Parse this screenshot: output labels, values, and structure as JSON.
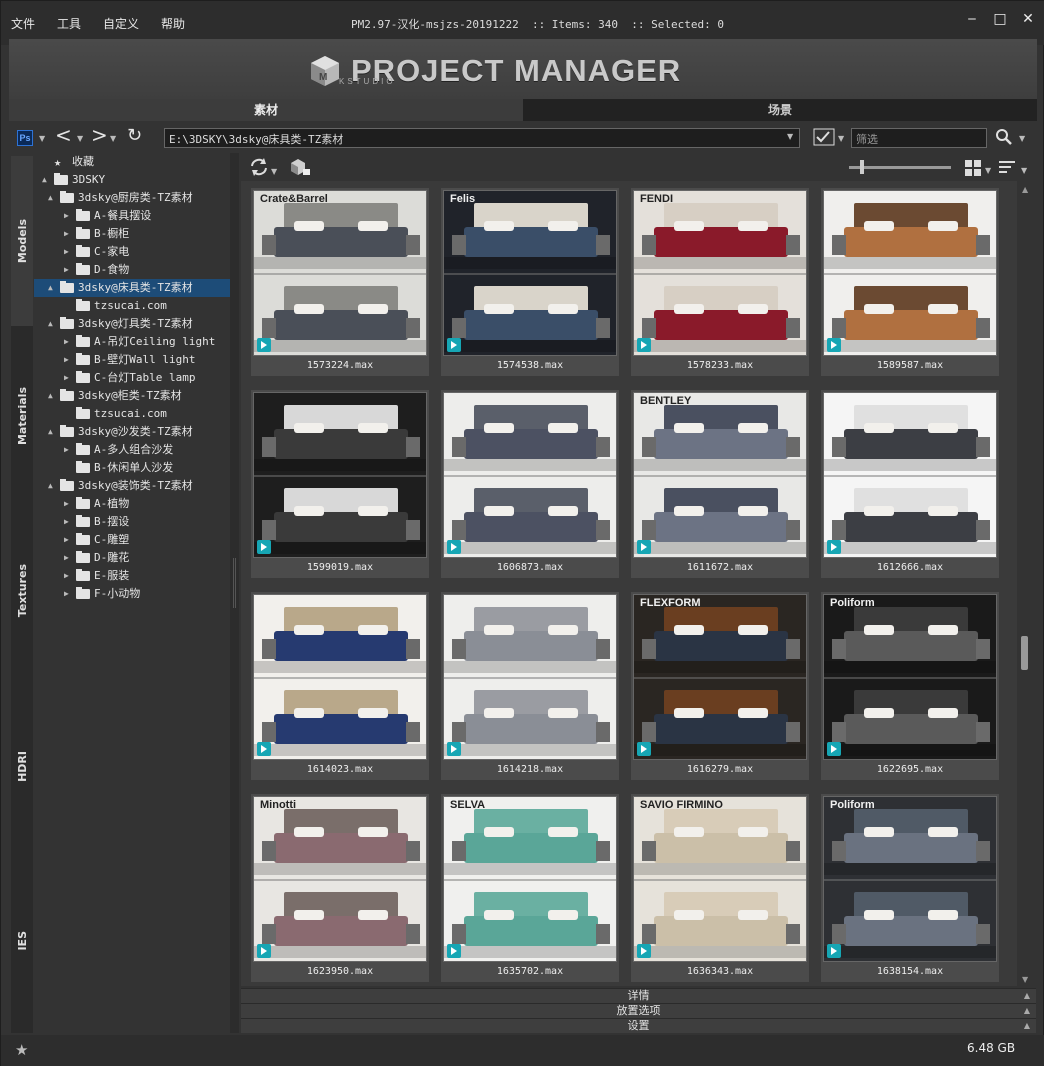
{
  "menu": {
    "items": [
      "文件",
      "工具",
      "自定义",
      "帮助"
    ]
  },
  "title": "PM2.97-汉化-msjzs-20191222  :: Items: 340  :: Selected: 0",
  "window_controls": {
    "minimize": "✕",
    "min": "‒",
    "max": "□",
    "close": "✕"
  },
  "banner": {
    "logo_text": "PROJECT MANAGER",
    "logo_sub": "KSTUDIO"
  },
  "main_tabs": [
    {
      "label": "素材",
      "active": true
    },
    {
      "label": "场景",
      "active": false
    }
  ],
  "toolbar": {
    "ps_label": "Ps",
    "path": "E:\\3DSKY\\3dsky@床具类-TZ素材",
    "filter_placeholder": "筛选"
  },
  "side_tabs": [
    {
      "label": "Models",
      "active": true
    },
    {
      "label": "Materials",
      "active": false
    },
    {
      "label": "Textures",
      "active": false
    },
    {
      "label": "HDRI",
      "active": false
    },
    {
      "label": "IES",
      "active": false
    }
  ],
  "tree": [
    {
      "label": "收藏",
      "depth": 0,
      "arrow": "",
      "icon": "star",
      "selected": false
    },
    {
      "label": "3DSKY",
      "depth": 0,
      "arrow": "▲",
      "icon": "folder",
      "selected": false
    },
    {
      "label": "3dsky@厨房类-TZ素材",
      "depth": 1,
      "arrow": "▲",
      "icon": "folder",
      "selected": false
    },
    {
      "label": "A-餐具摆设",
      "depth": 2,
      "arrow": "▶",
      "icon": "folder",
      "selected": false
    },
    {
      "label": "B-橱柜",
      "depth": 2,
      "arrow": "▶",
      "icon": "folder",
      "selected": false
    },
    {
      "label": "C-家电",
      "depth": 2,
      "arrow": "▶",
      "icon": "folder",
      "selected": false
    },
    {
      "label": "D-食物",
      "depth": 2,
      "arrow": "▶",
      "icon": "folder",
      "selected": false
    },
    {
      "label": "3dsky@床具类-TZ素材",
      "depth": 1,
      "arrow": "▲",
      "icon": "folder",
      "selected": true
    },
    {
      "label": "tzsucai.com",
      "depth": 2,
      "arrow": "",
      "icon": "folder",
      "selected": false
    },
    {
      "label": "3dsky@灯具类-TZ素材",
      "depth": 1,
      "arrow": "▲",
      "icon": "folder",
      "selected": false
    },
    {
      "label": "A-吊灯Ceiling light",
      "depth": 2,
      "arrow": "▶",
      "icon": "folder",
      "selected": false
    },
    {
      "label": "B-壁灯Wall light",
      "depth": 2,
      "arrow": "▶",
      "icon": "folder",
      "selected": false
    },
    {
      "label": "C-台灯Table lamp",
      "depth": 2,
      "arrow": "▶",
      "icon": "folder",
      "selected": false
    },
    {
      "label": "3dsky@柜类-TZ素材",
      "depth": 1,
      "arrow": "▲",
      "icon": "folder",
      "selected": false
    },
    {
      "label": "tzsucai.com",
      "depth": 2,
      "arrow": "",
      "icon": "folder",
      "selected": false
    },
    {
      "label": "3dsky@沙发类-TZ素材",
      "depth": 1,
      "arrow": "▲",
      "icon": "folder",
      "selected": false
    },
    {
      "label": "A-多人组合沙发",
      "depth": 2,
      "arrow": "▶",
      "icon": "folder",
      "selected": false
    },
    {
      "label": "B-休闲单人沙发",
      "depth": 2,
      "arrow": "",
      "icon": "folder",
      "selected": false
    },
    {
      "label": "3dsky@装饰类-TZ素材",
      "depth": 1,
      "arrow": "▲",
      "icon": "folder",
      "selected": false
    },
    {
      "label": "A-植物",
      "depth": 2,
      "arrow": "▶",
      "icon": "folder",
      "selected": false
    },
    {
      "label": "B-摆设",
      "depth": 2,
      "arrow": "▶",
      "icon": "folder",
      "selected": false
    },
    {
      "label": "C-雕塑",
      "depth": 2,
      "arrow": "▶",
      "icon": "folder",
      "selected": false
    },
    {
      "label": "D-雕花",
      "depth": 2,
      "arrow": "▶",
      "icon": "folder",
      "selected": false
    },
    {
      "label": "E-服装",
      "depth": 2,
      "arrow": "▶",
      "icon": "folder",
      "selected": false
    },
    {
      "label": "F-小动物",
      "depth": 2,
      "arrow": "▶",
      "icon": "folder",
      "selected": false
    }
  ],
  "items": [
    {
      "name": "1573224.max",
      "brand": "Crate&Barrel",
      "bg": "#dcdcd8",
      "bed": "#8a8a86",
      "cover": "#4a4f58"
    },
    {
      "name": "1574538.max",
      "brand": "Felis",
      "bg": "#20232a",
      "bed": "#d9d4ca",
      "cover": "#3a4e68"
    },
    {
      "name": "1578233.max",
      "brand": "FENDI",
      "bg": "#e4e0da",
      "bed": "#d7cfc4",
      "cover": "#8a1a2a"
    },
    {
      "name": "1589587.max",
      "brand": "",
      "bg": "#f0efed",
      "bed": "#6b4a32",
      "cover": "#b07040"
    },
    {
      "name": "1599019.max",
      "brand": "",
      "bg": "#1e1e1e",
      "bed": "#d8d8d8",
      "cover": "#3a3a3a"
    },
    {
      "name": "1606873.max",
      "brand": "",
      "bg": "#ededeb",
      "bed": "#5a5f6a",
      "cover": "#4c5162"
    },
    {
      "name": "1611672.max",
      "brand": "BENTLEY",
      "bg": "#e8e8e6",
      "bed": "#4a5060",
      "cover": "#6c7384"
    },
    {
      "name": "1612666.max",
      "brand": "",
      "bg": "#f5f5f5",
      "bed": "#e0e0e0",
      "cover": "#3c3e44"
    },
    {
      "name": "1614023.max",
      "brand": "",
      "bg": "#f2f0ec",
      "bed": "#b9a88a",
      "cover": "#263a70"
    },
    {
      "name": "1614218.max",
      "brand": "",
      "bg": "#eeeeec",
      "bed": "#9a9ca2",
      "cover": "#8a8e96"
    },
    {
      "name": "1616279.max",
      "brand": "FLEXFORM",
      "bg": "#2a2622",
      "bed": "#6a3e20",
      "cover": "#2a3444"
    },
    {
      "name": "1622695.max",
      "brand": "Poliform",
      "bg": "#1a1a1a",
      "bed": "#3a3a3a",
      "cover": "#5a5a5a"
    },
    {
      "name": "1623950.max",
      "brand": "Minotti",
      "bg": "#e8e6e2",
      "bed": "#7a6e6a",
      "cover": "#8a6a70"
    },
    {
      "name": "1635702.max",
      "brand": "SELVA",
      "bg": "#f0f0ee",
      "bed": "#6ab0a2",
      "cover": "#5aa698"
    },
    {
      "name": "1636343.max",
      "brand": "SAVIO FIRMINO",
      "bg": "#e6e2da",
      "bed": "#d8ccb8",
      "cover": "#cbbfa8"
    },
    {
      "name": "1638154.max",
      "brand": "Poliform",
      "bg": "#2e3034",
      "bed": "#505a66",
      "cover": "#6a7280"
    }
  ],
  "panels": [
    "详情",
    "放置选项",
    "设置"
  ],
  "status": {
    "disk_size": "6.48 GB"
  }
}
